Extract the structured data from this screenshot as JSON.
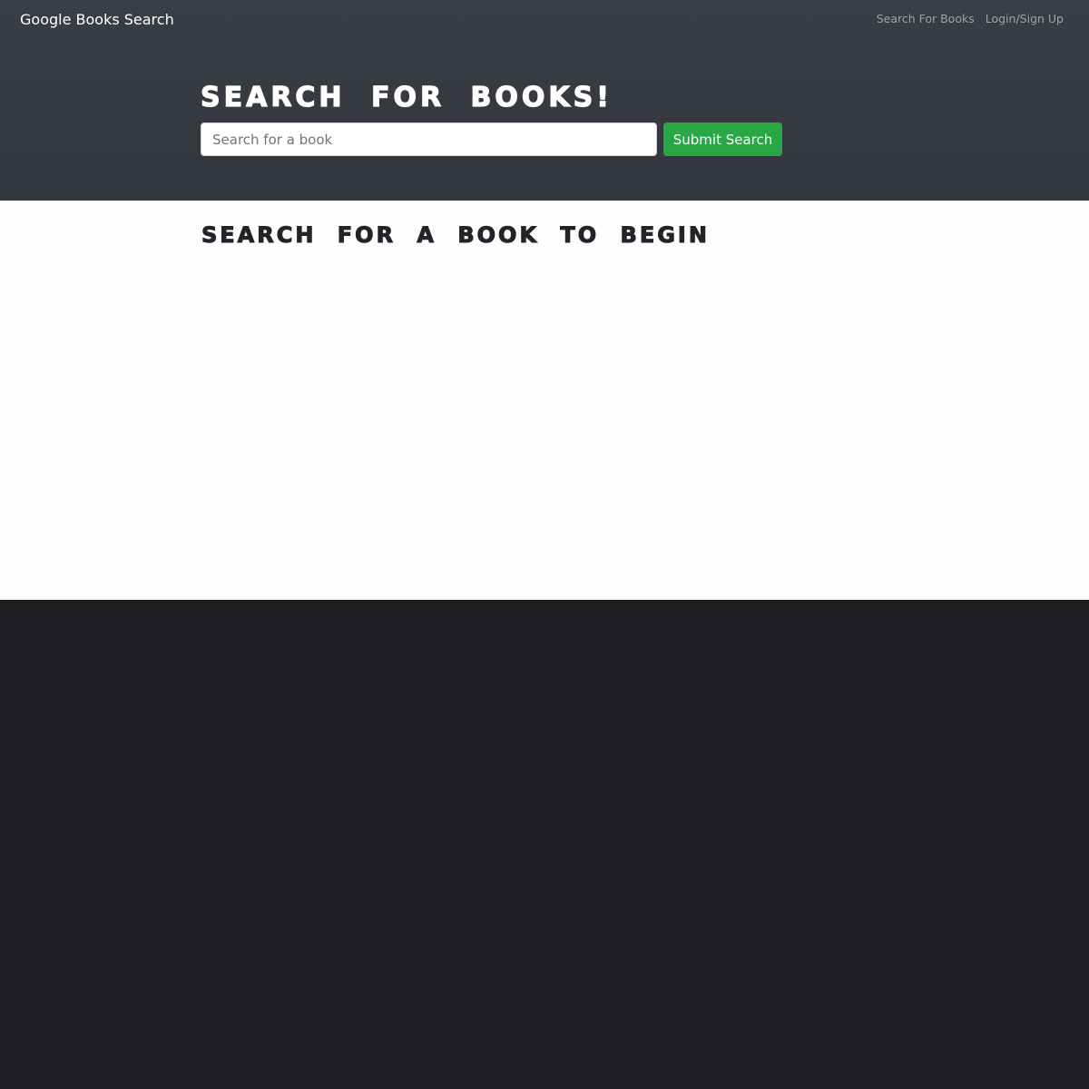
{
  "navbar": {
    "brand": "Google Books Search",
    "links": [
      {
        "label": "Search For Books"
      },
      {
        "label": "Login/Sign Up"
      }
    ]
  },
  "hero": {
    "title": "Search for Books!",
    "search_placeholder": "Search for a book",
    "search_value": "",
    "submit_label": "Submit Search"
  },
  "results": {
    "empty_message": "Search for a book to begin"
  },
  "colors": {
    "navbar_bg": "#343a40",
    "submit_button": "#28a745",
    "page_bg": "#1c1e22"
  }
}
